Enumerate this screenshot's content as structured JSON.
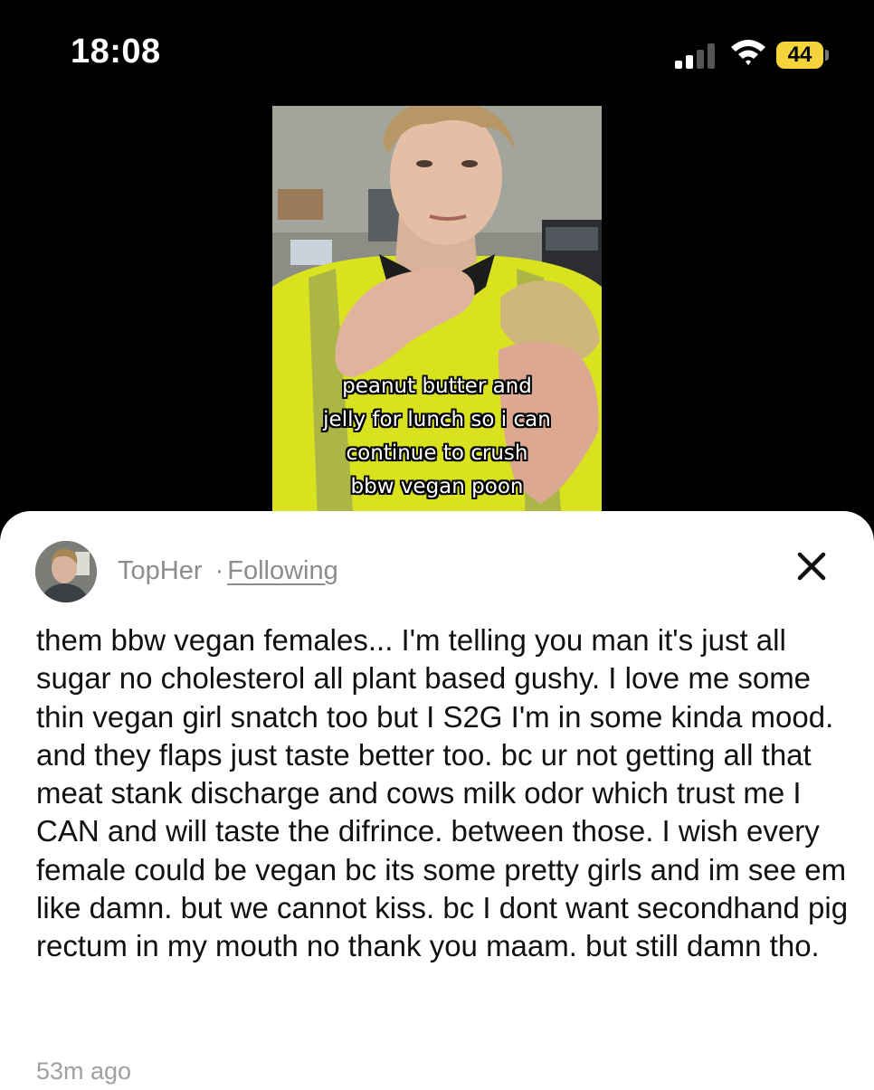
{
  "status_bar": {
    "time": "18:08",
    "battery": "44",
    "signal_bars_active": 2,
    "signal_bars_total": 4
  },
  "video": {
    "caption_lines": [
      "peanut butter and",
      "jelly for lunch so i can",
      "continue to crush",
      "bbw vegan poon"
    ]
  },
  "comment": {
    "author": "TopHer",
    "separator": "·",
    "follow_status": "Following",
    "text": "them bbw vegan females... I'm telling you man it's just all sugar no cholesterol all plant based gushy. I love me some thin vegan girl snatch too but I S2G I'm in some kinda mood. and they flaps just taste better too. bc ur not getting all that meat stank discharge and cows milk odor which trust me I CAN and will taste the difrince. between those. I wish every female could be vegan bc its some pretty girls and im see em like damn. but we cannot kiss. bc I dont want secondhand pig rectum in my mouth no thank you maam. but still damn tho.",
    "timestamp": "53m ago"
  },
  "icons": {
    "close": "close-icon",
    "wifi": "wifi-icon",
    "signal": "cellular-signal-icon",
    "battery": "battery-icon"
  },
  "colors": {
    "battery": "#f5d33a",
    "vest": "#d8e21e",
    "sheet_bg": "#ffffff",
    "muted_text": "#8c8c8c"
  }
}
